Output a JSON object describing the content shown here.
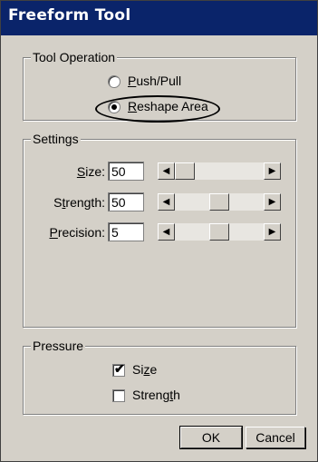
{
  "window": {
    "title": "Freeform Tool"
  },
  "tool_operation": {
    "legend": "Tool Operation",
    "options": [
      {
        "pre": "",
        "accel": "P",
        "post": "ush/Pull",
        "selected": false
      },
      {
        "pre": "",
        "accel": "R",
        "post": "eshape Area",
        "selected": true
      }
    ]
  },
  "settings": {
    "legend": "Settings",
    "fields": [
      {
        "pre": "",
        "accel": "S",
        "post": "ize:",
        "value": "50",
        "slider_level": 0.0
      },
      {
        "pre": "S",
        "accel": "t",
        "post": "rength:",
        "value": "50",
        "slider_level": 0.5
      },
      {
        "pre": "",
        "accel": "P",
        "post": "recision:",
        "value": "5",
        "slider_level": 0.5
      }
    ],
    "left_arrow": "◀",
    "right_arrow": "▶"
  },
  "pressure": {
    "legend": "Pressure",
    "options": [
      {
        "pre": "Si",
        "accel": "z",
        "post": "e",
        "checked": true
      },
      {
        "pre": "Streng",
        "accel": "t",
        "post": "h",
        "checked": false
      }
    ],
    "checkmark": "✔"
  },
  "buttons": {
    "ok": "OK",
    "cancel": "Cancel"
  }
}
